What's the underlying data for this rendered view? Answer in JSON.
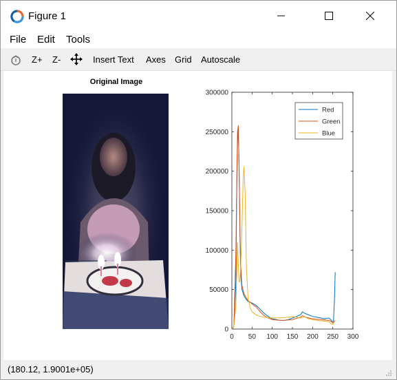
{
  "window": {
    "title": "Figure 1",
    "minimize_icon": "minimize-icon",
    "maximize_icon": "maximize-icon",
    "close_icon": "close-icon"
  },
  "menu": [
    "File",
    "Edit",
    "Tools"
  ],
  "toolbar": {
    "rotate_icon": "rotate-icon",
    "zoom_in": "Z+",
    "zoom_out": "Z-",
    "pan_icon": "pan-icon",
    "insert_text": "Insert Text",
    "axes": "Axes",
    "grid": "Grid",
    "autoscale": "Autoscale"
  },
  "figure": {
    "image_title": "Original Image"
  },
  "chart_data": {
    "type": "line",
    "xlim": [
      0,
      300
    ],
    "ylim": [
      0,
      300000
    ],
    "xticks": [
      "0",
      "50",
      "100",
      "150",
      "200",
      "250",
      "300"
    ],
    "yticks": [
      "0",
      "50000",
      "100000",
      "150000",
      "200000",
      "250000",
      "300000"
    ],
    "legend_position": "top-right",
    "colors": {
      "Red": "#0072bd",
      "Green": "#d95319",
      "Blue": "#edb120"
    },
    "series": [
      {
        "name": "Red",
        "x": [
          0,
          5,
          10,
          12,
          14,
          16,
          18,
          20,
          22,
          25,
          30,
          35,
          40,
          50,
          60,
          70,
          80,
          90,
          100,
          110,
          120,
          130,
          140,
          150,
          160,
          170,
          175,
          180,
          190,
          200,
          210,
          220,
          230,
          240,
          245,
          250,
          252,
          254,
          256
        ],
        "y": [
          0,
          3000,
          60000,
          170000,
          235000,
          255000,
          200000,
          120000,
          70000,
          50000,
          42000,
          38000,
          35000,
          33000,
          30000,
          25000,
          20000,
          16000,
          13000,
          12000,
          11000,
          11000,
          12000,
          14000,
          16000,
          18000,
          22000,
          20000,
          18000,
          16000,
          15000,
          14000,
          13000,
          14000,
          12000,
          8000,
          12000,
          35000,
          72000
        ]
      },
      {
        "name": "Green",
        "x": [
          0,
          5,
          10,
          12,
          14,
          16,
          18,
          20,
          22,
          25,
          30,
          35,
          40,
          50,
          60,
          70,
          80,
          90,
          100,
          110,
          120,
          130,
          140,
          150,
          160,
          170,
          175,
          180,
          190,
          200,
          210,
          220,
          230,
          240,
          245,
          250,
          252,
          254,
          256
        ],
        "y": [
          0,
          3000,
          100000,
          180000,
          250000,
          258000,
          200000,
          130000,
          80000,
          55000,
          45000,
          40000,
          36000,
          32000,
          28000,
          22000,
          17000,
          14000,
          12000,
          11500,
          11000,
          11000,
          11500,
          12000,
          13500,
          15000,
          17000,
          15500,
          14000,
          13000,
          12500,
          12000,
          11500,
          11000,
          10000,
          8000,
          9000,
          10000,
          11000
        ]
      },
      {
        "name": "Blue",
        "x": [
          0,
          5,
          10,
          14,
          16,
          18,
          20,
          22,
          25,
          28,
          30,
          33,
          36,
          40,
          45,
          50,
          60,
          70,
          80,
          90,
          100,
          110,
          120,
          130,
          140,
          150,
          160,
          170,
          180,
          190,
          200,
          210,
          220,
          230,
          240,
          245,
          250,
          255
        ],
        "y": [
          0,
          3000,
          30000,
          110000,
          80000,
          60000,
          60000,
          80000,
          130000,
          190000,
          206000,
          170000,
          80000,
          38000,
          28000,
          22000,
          18000,
          16000,
          15000,
          14500,
          14000,
          14000,
          14000,
          14500,
          15000,
          16000,
          15000,
          14000,
          15500,
          13000,
          12000,
          11000,
          10500,
          10000,
          9500,
          7000,
          6000,
          9000
        ]
      }
    ]
  },
  "status": {
    "coords": "(180.12, 1.9001e+05)"
  }
}
